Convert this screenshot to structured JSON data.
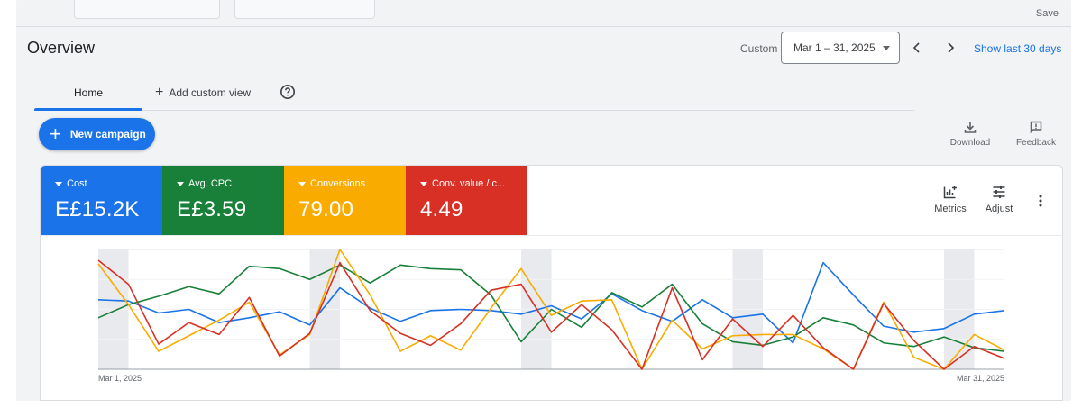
{
  "header": {
    "save_label": "Save",
    "title": "Overview",
    "custom_label": "Custom",
    "date_range": "Mar 1 – 31, 2025",
    "show_last_label": "Show last 30 days"
  },
  "tabs": {
    "home_label": "Home",
    "add_view_label": "Add custom view"
  },
  "actions": {
    "new_campaign_label": "New campaign",
    "download_label": "Download",
    "feedback_label": "Feedback"
  },
  "metrics": [
    {
      "label": "Cost",
      "value": "E£15.2K",
      "color": "#1a73e8"
    },
    {
      "label": "Avg. CPC",
      "value": "E£3.59",
      "color": "#188038"
    },
    {
      "label": "Conversions",
      "value": "79.00",
      "color": "#f9ab00"
    },
    {
      "label": "Conv. value / c...",
      "value": "4.49",
      "color": "#d93025"
    }
  ],
  "card_tools": {
    "metrics_label": "Metrics",
    "adjust_label": "Adjust"
  },
  "chart_data": {
    "type": "line",
    "x_start_label": "Mar 1, 2025",
    "x_end_label": "Mar 31, 2025",
    "x": [
      1,
      2,
      3,
      4,
      5,
      6,
      7,
      8,
      9,
      10,
      11,
      12,
      13,
      14,
      15,
      16,
      17,
      18,
      19,
      20,
      21,
      22,
      23,
      24,
      25,
      26,
      27,
      28,
      29,
      30,
      31
    ],
    "weekend_bands": [
      [
        1,
        2
      ],
      [
        8,
        9
      ],
      [
        15,
        16
      ],
      [
        22,
        23
      ],
      [
        29,
        30
      ]
    ],
    "ylim": [
      0,
      100
    ],
    "grid": true,
    "series": [
      {
        "color": "#1a73e8",
        "values": [
          58,
          57,
          47,
          50,
          39,
          43,
          48,
          37,
          68,
          51,
          40,
          49,
          50,
          49,
          46,
          53,
          42,
          63,
          49,
          40,
          58,
          43,
          46,
          22,
          89,
          62,
          36,
          31,
          34,
          46,
          49
        ]
      },
      {
        "color": "#188038",
        "values": [
          43,
          54,
          61,
          69,
          63,
          86,
          84,
          75,
          87,
          72,
          87,
          84,
          83,
          62,
          23,
          50,
          35,
          64,
          52,
          71,
          38,
          23,
          20,
          27,
          43,
          37,
          22,
          19,
          27,
          18,
          15
        ]
      },
      {
        "color": "#f9ab00",
        "values": [
          88,
          54,
          15,
          28,
          41,
          56,
          12,
          29,
          100,
          62,
          15,
          28,
          16,
          51,
          84,
          45,
          57,
          58,
          0,
          41,
          17,
          28,
          29,
          29,
          17,
          0,
          56,
          10,
          0,
          29,
          16
        ]
      },
      {
        "color": "#d93025",
        "values": [
          91,
          71,
          21,
          39,
          29,
          60,
          11,
          30,
          89,
          49,
          30,
          20,
          38,
          66,
          71,
          31,
          54,
          33,
          0,
          68,
          8,
          42,
          19,
          45,
          18,
          0,
          55,
          24,
          0,
          19,
          9
        ]
      }
    ]
  }
}
